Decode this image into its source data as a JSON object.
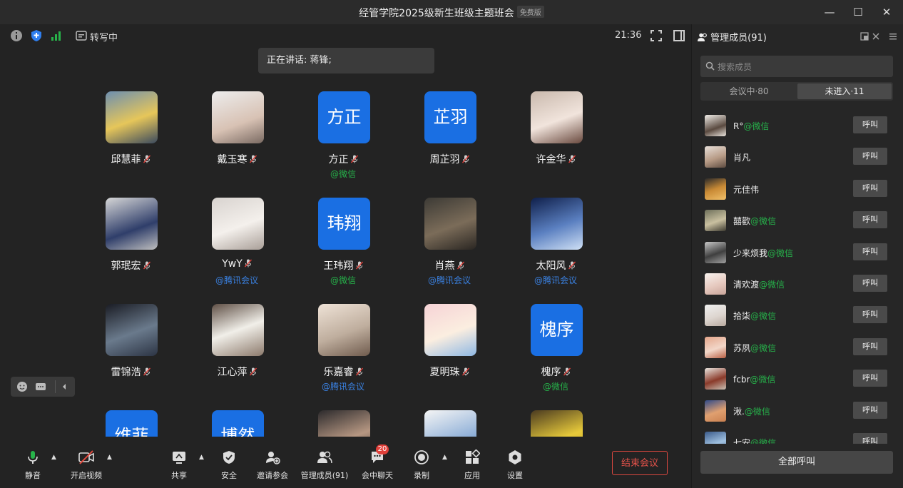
{
  "window": {
    "title": "经管学院2025级新生班级主题班会",
    "badge": "免费版"
  },
  "topinfo": {
    "transcribe": "转写中",
    "time": "21:36"
  },
  "speaking": "正在讲话: 蒋锋;",
  "participants": [
    {
      "name": "邱慧菲",
      "sub": "",
      "avatar_text": ""
    },
    {
      "name": "戴玉寒",
      "sub": "",
      "avatar_text": ""
    },
    {
      "name": "方正",
      "sub": "@微信",
      "avatar_text": "方正"
    },
    {
      "name": "周芷羽",
      "sub": "",
      "avatar_text": "芷羽"
    },
    {
      "name": "许金华",
      "sub": "",
      "avatar_text": ""
    },
    {
      "name": "郭珉宏",
      "sub": "",
      "avatar_text": ""
    },
    {
      "name": "YwY",
      "sub": "@腾讯会议",
      "avatar_text": ""
    },
    {
      "name": "王玮翔",
      "sub": "@微信",
      "avatar_text": "玮翔"
    },
    {
      "name": "肖燕",
      "sub": "@腾讯会议",
      "avatar_text": ""
    },
    {
      "name": "太阳风",
      "sub": "@腾讯会议",
      "avatar_text": ""
    },
    {
      "name": "雷锦浩",
      "sub": "",
      "avatar_text": ""
    },
    {
      "name": "江心萍",
      "sub": "",
      "avatar_text": ""
    },
    {
      "name": "乐嘉睿",
      "sub": "@腾讯会议",
      "avatar_text": ""
    },
    {
      "name": "夏明珠",
      "sub": "",
      "avatar_text": ""
    },
    {
      "name": "槐序",
      "sub": "@微信",
      "avatar_text": "槐序"
    },
    {
      "name": "",
      "sub": "",
      "avatar_text": "维菲"
    },
    {
      "name": "",
      "sub": "",
      "avatar_text": "博然"
    },
    {
      "name": "",
      "sub": "",
      "avatar_text": ""
    },
    {
      "name": "",
      "sub": "",
      "avatar_text": ""
    },
    {
      "name": "",
      "sub": "",
      "avatar_text": ""
    }
  ],
  "toolbar": {
    "mute": "静音",
    "video": "开启视频",
    "share": "共享",
    "security": "安全",
    "invite": "邀请参会",
    "members": "管理成员(91)",
    "chat": "会中聊天",
    "chat_badge": "20",
    "record": "录制",
    "apps": "应用",
    "settings": "设置",
    "end": "结束会议"
  },
  "sidebar": {
    "title": "管理成员(91)",
    "search_placeholder": "搜索成员",
    "tab_in": "会议中·80",
    "tab_out": "未进入·11",
    "call_label": "呼叫",
    "call_all": "全部呼叫",
    "members": [
      {
        "name": "R°",
        "sub": "@微信"
      },
      {
        "name": "肖凡",
        "sub": ""
      },
      {
        "name": "元佳伟",
        "sub": ""
      },
      {
        "name": "囍歡",
        "sub": "@微信"
      },
      {
        "name": "少来烦我",
        "sub": "@微信"
      },
      {
        "name": "清欢渡",
        "sub": "@微信"
      },
      {
        "name": "拾柒",
        "sub": "@微信"
      },
      {
        "name": "苏夙",
        "sub": "@微信"
      },
      {
        "name": "fcbr",
        "sub": "@微信"
      },
      {
        "name": "湫.",
        "sub": "@微信"
      },
      {
        "name": "七安",
        "sub": "@微信"
      }
    ]
  },
  "colors": {
    "accent": "#1a6fe3",
    "wechat": "#26b24a",
    "tencent": "#3a80e0",
    "danger": "#d9473f"
  }
}
